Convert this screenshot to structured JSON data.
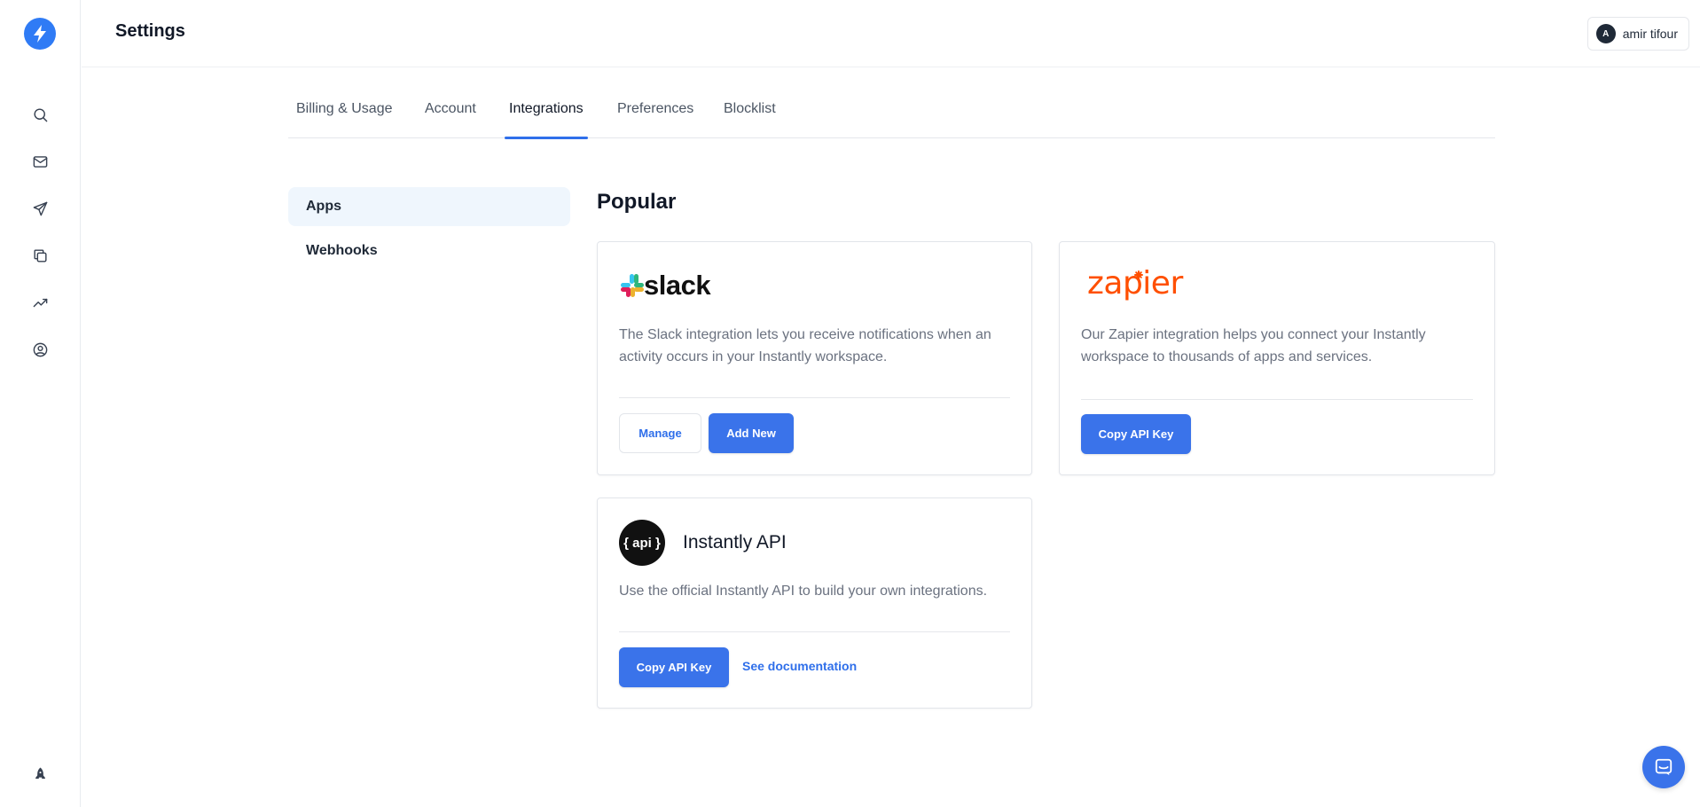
{
  "header": {
    "title": "Settings"
  },
  "user": {
    "initial": "A",
    "name": "amir tifour"
  },
  "sidebar": {
    "icons": [
      "search-icon",
      "mail-icon",
      "send-icon",
      "copy-icon",
      "analytics-icon",
      "user-circle-icon"
    ],
    "bottom_icon": "rocket-icon"
  },
  "tabs": [
    {
      "label": "Billing & Usage"
    },
    {
      "label": "Account"
    },
    {
      "label": "Integrations",
      "active": true
    },
    {
      "label": "Preferences"
    },
    {
      "label": "Blocklist"
    }
  ],
  "submenu": [
    {
      "label": "Apps",
      "active": true
    },
    {
      "label": "Webhooks"
    }
  ],
  "section": {
    "title": "Popular"
  },
  "cards": {
    "slack": {
      "logo_text": "slack",
      "description_line1": "The Slack integration lets you receive notifications when an",
      "description_line2": "activity occurs in your Instantly workspace.",
      "manage_label": "Manage",
      "add_label": "Add New"
    },
    "zapier": {
      "logo_text": "zapier",
      "description_line1": "Our Zapier integration helps you connect your Instantly",
      "description_line2": "workspace to thousands of apps and services.",
      "copy_label": "Copy API Key"
    },
    "api": {
      "logo_text": "{ api }",
      "title": "Instantly API",
      "description": "Use the official Instantly API to build your own integrations.",
      "copy_label": "Copy API Key",
      "docs_label": "See documentation"
    }
  },
  "colors": {
    "accent": "#3a73ea",
    "brand_logo": "#2f7bf5",
    "zapier": "#ff4f00"
  }
}
